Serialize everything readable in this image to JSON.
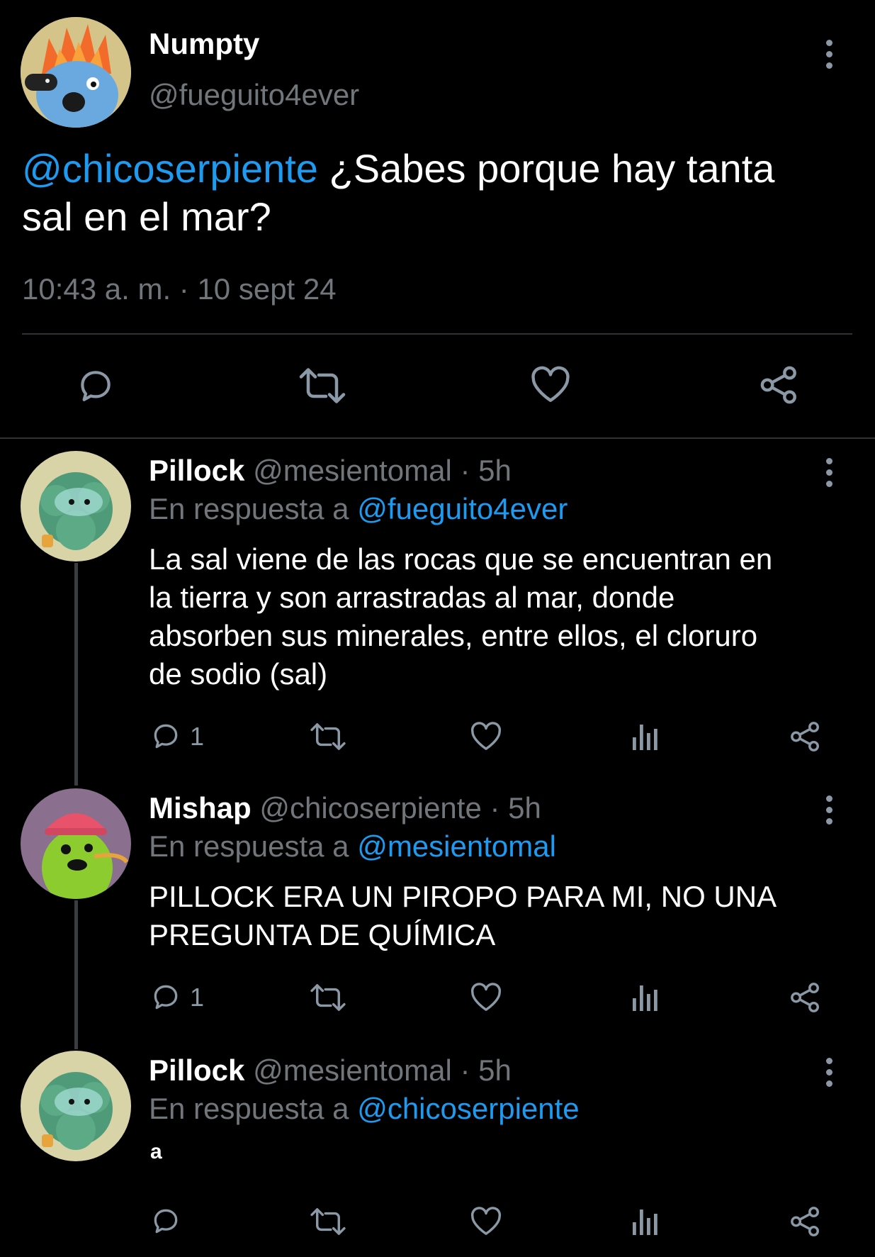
{
  "main_tweet": {
    "display_name": "Numpty",
    "handle": "@fueguito4ever",
    "mention": "@chicoserpiente",
    "text_line1": "¿Sabes porque hay tanta",
    "text_line2": "sal en el mar?",
    "timestamp": "10:43 a. m. · 10 sept 24"
  },
  "replies": [
    {
      "display_name": "Pillock",
      "handle": "@mesientomal",
      "time": "· 5h",
      "reply_prefix": "En respuesta a",
      "reply_to": "@fueguito4ever",
      "lines": [
        "La sal viene de las rocas que se encuentran en",
        "la tierra y son arrastradas al mar, donde",
        "absorben sus minerales, entre ellos, el cloruro",
        "de sodio (sal)"
      ],
      "reply_count": "1"
    },
    {
      "display_name": "Mishap",
      "handle": "@chicoserpiente",
      "time": "· 5h",
      "reply_prefix": "En respuesta a",
      "reply_to": "@mesientomal",
      "lines": [
        "PILLOCK ERA UN PIROPO PARA MI, NO UNA",
        "PREGUNTA DE QUÍMICA"
      ],
      "reply_count": "1"
    },
    {
      "display_name": "Pillock",
      "handle": "@mesientomal",
      "time": "· 5h",
      "reply_prefix": "En respuesta a",
      "reply_to": "@chicoserpiente",
      "lines": [
        "a"
      ],
      "reply_count": ""
    }
  ],
  "icons": {
    "reply": "reply-icon",
    "retweet": "retweet-icon",
    "like": "heart-icon",
    "views": "views-icon",
    "share": "share-icon",
    "more": "more-icon"
  },
  "colors": {
    "background": "#000000",
    "text": "#e7e9ea",
    "muted": "#71767b",
    "link": "#1d9bf0"
  }
}
